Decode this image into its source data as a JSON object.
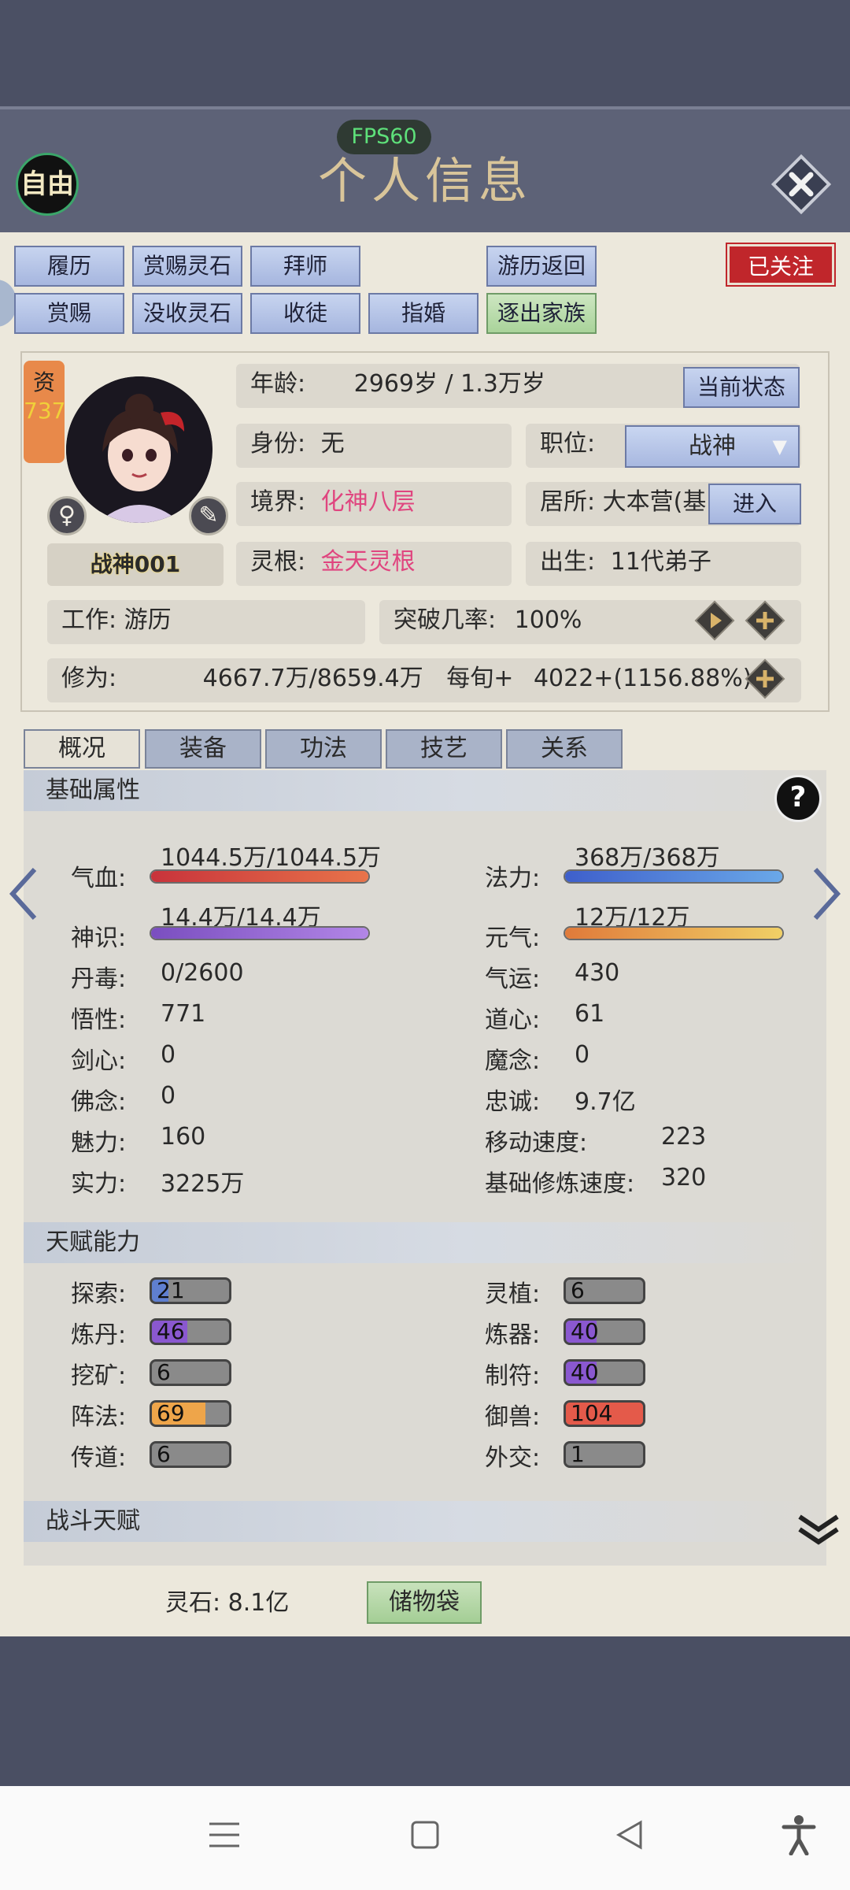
{
  "header": {
    "fps": "FPS60",
    "mode": "自由",
    "title": "个人信息"
  },
  "actions": {
    "row1": [
      "履历",
      "赏赐灵石",
      "拜师",
      "游历返回"
    ],
    "row2": [
      "赏赐",
      "没收灵石",
      "收徒",
      "指婚",
      "逐出家族"
    ],
    "follow": "已关注"
  },
  "character": {
    "aptitude_label": "资",
    "aptitude_value": "737",
    "name": "战神001",
    "gender_icon": "female-icon",
    "age_label": "年龄:",
    "age_value": "2969岁 / 1.3万岁",
    "status_button": "当前状态",
    "identity_label": "身份:",
    "identity_value": "无",
    "position_label": "职位:",
    "position_value": "战神",
    "realm_label": "境界:",
    "realm_value": "化神八层",
    "residence_label": "居所:",
    "residence_value": "大本营(基",
    "enter_button": "进入",
    "root_label": "灵根:",
    "root_value": "金天灵根",
    "birth_label": "出生:",
    "birth_value": "11代弟子",
    "work_label": "工作:",
    "work_value": "游历",
    "breakthrough_label": "突破几率:",
    "breakthrough_value": "100%",
    "cultivation_label": "修为:",
    "cultivation_value": "4667.7万/8659.4万",
    "per_turn_label": "每旬+",
    "per_turn_value": "4022+(1156.88%)"
  },
  "tabs": [
    "概况",
    "装备",
    "功法",
    "技艺",
    "关系"
  ],
  "basic": {
    "title": "基础属性",
    "hp_label": "气血:",
    "hp_value": "1044.5万/1044.5万",
    "hp_fraction": 1.0,
    "mana_label": "法力:",
    "mana_value": "368万/368万",
    "mana_fraction": 1.0,
    "sense_label": "神识:",
    "sense_value": "14.4万/14.4万",
    "sense_fraction": 1.0,
    "vital_label": "元气:",
    "vital_value": "12万/12万",
    "vital_fraction": 1.0,
    "stats_left": [
      {
        "label": "丹毒:",
        "value": "0/2600"
      },
      {
        "label": "悟性:",
        "value": "771"
      },
      {
        "label": "剑心:",
        "value": "0"
      },
      {
        "label": "佛念:",
        "value": "0"
      },
      {
        "label": "魅力:",
        "value": "160"
      },
      {
        "label": "实力:",
        "value": "3225万"
      }
    ],
    "stats_right": [
      {
        "label": "气运:",
        "value": "430"
      },
      {
        "label": "道心:",
        "value": "61"
      },
      {
        "label": "魔念:",
        "value": "0"
      },
      {
        "label": "忠诚:",
        "value": "9.7亿"
      },
      {
        "label": "移动速度:",
        "value": "223"
      },
      {
        "label": "基础修炼速度:",
        "value": "320"
      }
    ]
  },
  "talent": {
    "title": "天赋能力",
    "left": [
      {
        "label": "探索:",
        "value": "21",
        "fraction": 0.21,
        "color": "#5f7fd0"
      },
      {
        "label": "炼丹:",
        "value": "46",
        "fraction": 0.46,
        "color": "#8a58d0"
      },
      {
        "label": "挖矿:",
        "value": "6",
        "fraction": 0.06,
        "color": "#8a8a8a"
      },
      {
        "label": "阵法:",
        "value": "69",
        "fraction": 0.69,
        "color": "#eea54a"
      },
      {
        "label": "传道:",
        "value": "6",
        "fraction": 0.06,
        "color": "#8a8a8a"
      }
    ],
    "right": [
      {
        "label": "灵植:",
        "value": "6",
        "fraction": 0.06,
        "color": "#8a8a8a"
      },
      {
        "label": "炼器:",
        "value": "40",
        "fraction": 0.4,
        "color": "#8a58d0"
      },
      {
        "label": "制符:",
        "value": "40",
        "fraction": 0.4,
        "color": "#8a58d0"
      },
      {
        "label": "御兽:",
        "value": "104",
        "fraction": 1.0,
        "color": "#e45a4a"
      },
      {
        "label": "外交:",
        "value": "1",
        "fraction": 0.01,
        "color": "#8a8a8a"
      }
    ]
  },
  "combat": {
    "title": "战斗天赋"
  },
  "footer": {
    "stone_label": "灵石:",
    "stone_value": "8.1亿",
    "bag_button": "储物袋"
  }
}
